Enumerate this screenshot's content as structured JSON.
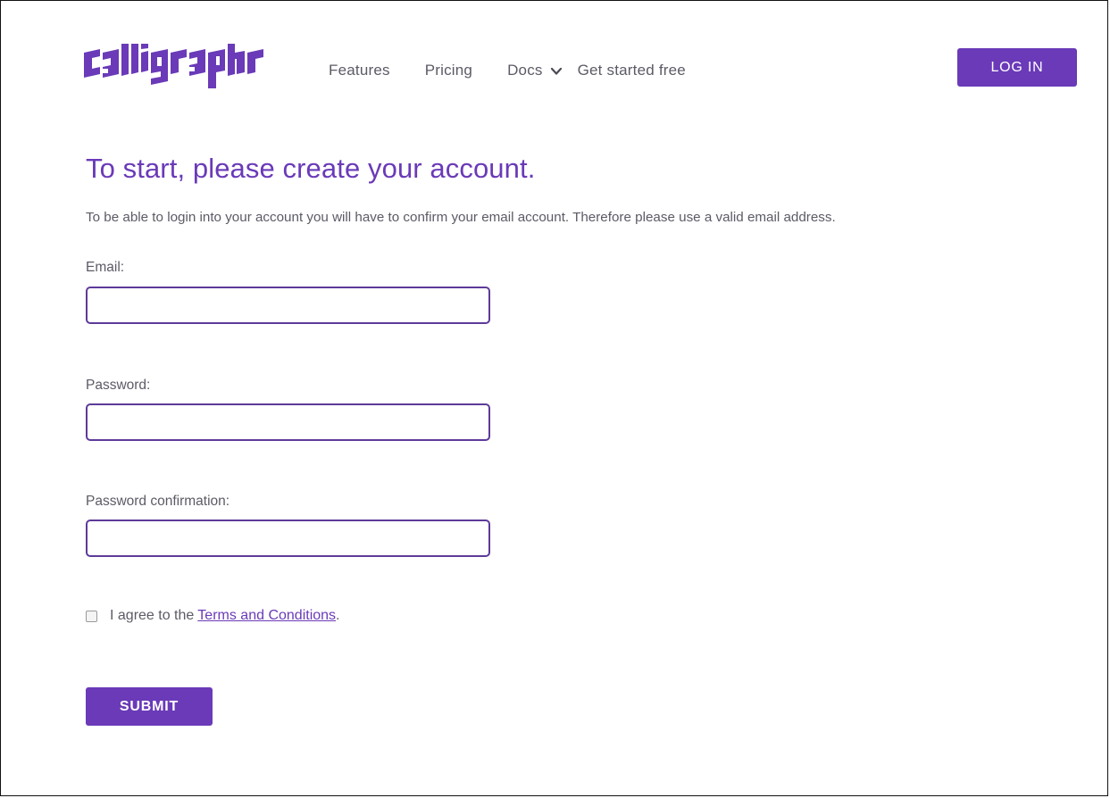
{
  "brand": {
    "logo_text": "calligraphr",
    "accent_color": "#6a3ab8"
  },
  "nav": {
    "items": [
      {
        "label": "Features"
      },
      {
        "label": "Pricing"
      },
      {
        "label": "Docs",
        "icon": "chevron-down-icon"
      },
      {
        "label": "Get started free"
      }
    ],
    "login_label": "LOG IN"
  },
  "form": {
    "title": "To start, please create your account.",
    "intro": "To be able to login into your account you will have to confirm your email account. Therefore please use a valid email address.",
    "email": {
      "label": "Email:",
      "value": "",
      "placeholder": ""
    },
    "password": {
      "label": "Password:",
      "value": "",
      "placeholder": ""
    },
    "password_confirmation": {
      "label": "Password confirmation:",
      "value": "",
      "placeholder": ""
    },
    "agree": {
      "prefix": "I agree to the",
      "link_text": "Terms and Conditions",
      "suffix": ".",
      "checked": false
    },
    "submit_label": "SUBMIT"
  }
}
